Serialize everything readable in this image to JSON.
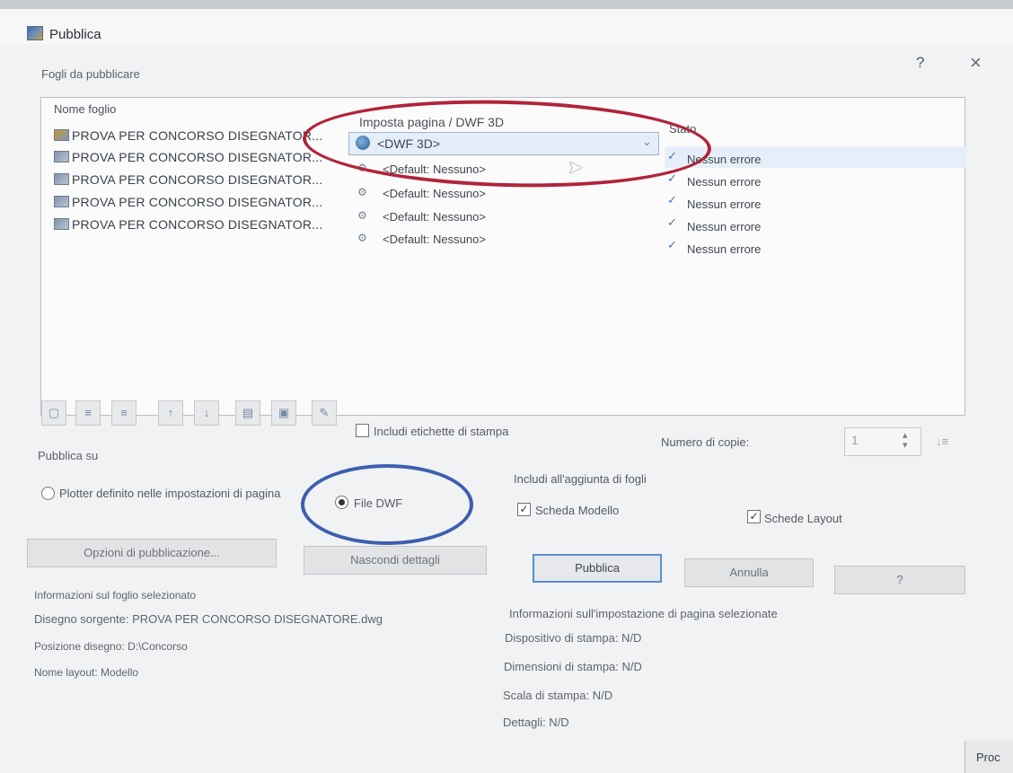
{
  "window": {
    "title": "Pubblica",
    "help_glyph": "?",
    "close_glyph": "×"
  },
  "sheets_section": {
    "label": "Fogli da pubblicare",
    "columns": {
      "name": "Nome foglio",
      "setup": "Imposta pagina / DWF 3D",
      "status": "Stato"
    },
    "rows": [
      {
        "name": "PROVA PER CONCORSO DISEGNATOR...",
        "setup": "<DWF 3D>",
        "status": "Nessun errore"
      },
      {
        "name": "PROVA PER CONCORSO DISEGNATOR...",
        "setup": "<Default: Nessuno>",
        "status": "Nessun errore"
      },
      {
        "name": "PROVA PER CONCORSO DISEGNATOR...",
        "setup": "<Default: Nessuno>",
        "status": "Nessun errore"
      },
      {
        "name": "PROVA PER CONCORSO DISEGNATOR...",
        "setup": "<Default: Nessuno>",
        "status": "Nessun errore"
      },
      {
        "name": "PROVA PER CONCORSO DISEGNATOR...",
        "setup": "<Default: Nessuno>",
        "status": "Nessun errore"
      }
    ]
  },
  "toolbar": {
    "include_stamp_label": "Includi etichette di stampa",
    "copies_label": "Numero di copie:",
    "copies_value": "1"
  },
  "publish_to": {
    "label": "Pubblica su",
    "option_plotter": "Plotter definito nelle impostazioni di pagina",
    "option_dwf": "File DWF"
  },
  "include_on_add": {
    "label": "Includi all'aggiunta di fogli",
    "model_tab": "Scheda Modello",
    "layout_tabs": "Schede Layout"
  },
  "buttons": {
    "publish_options": "Opzioni di pubblicazione...",
    "hide_details": "Nascondi dettagli",
    "publish": "Pubblica",
    "cancel": "Annulla",
    "help": "?"
  },
  "sheet_info": {
    "label": "Informazioni sul foglio selezionato",
    "source_drawing": "Disegno sorgente: PROVA PER CONCORSO DISEGNATORE.dwg",
    "drawing_location": "Posizione disegno: D:\\Concorso",
    "layout_name": "Nome layout: Modello"
  },
  "page_setup_info": {
    "label": "Informazioni sull'impostazione di pagina selezionate",
    "plot_device": "Dispositivo di stampa: N/D",
    "plot_size": "Dimensioni di stampa: N/D",
    "plot_scale": "Scala di stampa: N/D",
    "details": "Dettagli: N/D"
  },
  "taskbar": {
    "text": "Proc"
  },
  "colors": {
    "red_annotation": "#b0243a",
    "blue_annotation": "#3d5fb0",
    "check_blue": "#3c74c4"
  },
  "icons": [
    "app-icon",
    "sheet-icon",
    "page-setup-icon",
    "dwf-globe-icon",
    "check-icon",
    "chevron-down-icon",
    "cursor-icon"
  ]
}
